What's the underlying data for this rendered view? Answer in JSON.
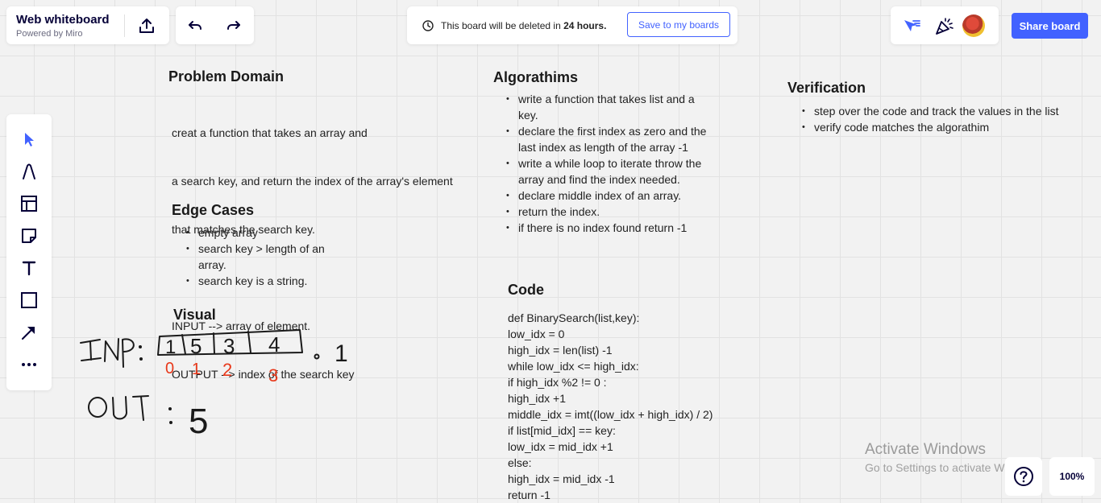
{
  "header": {
    "board_title": "Web whiteboard",
    "powered_by": "Powered by Miro",
    "notice_prefix": "This board will be deleted in ",
    "notice_hours": "24 hours.",
    "save_label": "Save to my boards",
    "share_label": "Share board"
  },
  "toolbar": {
    "tools": [
      "select-icon",
      "pen-icon",
      "frame-icon",
      "sticky-note-icon",
      "text-icon",
      "shape-icon",
      "connector-arrow-icon",
      "more-icon"
    ]
  },
  "problem": {
    "title": "Problem Domain",
    "lines": [
      "creat a function that takes an array and",
      "a search key, and return the index of the array's element",
      "that matches the search key.",
      "",
      "INPUT --> array of element.",
      "OUTPUT --> index of the search key"
    ]
  },
  "edge": {
    "title": "Edge Cases",
    "items": [
      "empty array",
      "search key > length of an array.",
      "search key is a string."
    ]
  },
  "visual": {
    "title": "Visual",
    "inp_label": "INP:",
    "array_values": [
      "1",
      "5",
      "3",
      "4"
    ],
    "index_values": [
      "0",
      "1",
      "2",
      "3"
    ],
    "key_value": "1",
    "out_label": "OUT",
    "out_value": "5"
  },
  "algorithms": {
    "title": "Algorathims",
    "items": [
      "write a function that takes list and a key.",
      "declare the first index as zero and the last index as length of the array -1",
      "write a while loop to iterate throw the array and find the index needed.",
      "declare middle index of an array.",
      "return the index.",
      "if there is no index found return -1"
    ]
  },
  "code": {
    "title": "Code",
    "lines": [
      "def BinarySearch(list,key):",
      "low_idx = 0",
      "high_idx = len(list) -1",
      "while low_idx <= high_idx:",
      "if high_idx %2 != 0 :",
      "high_idx +1",
      "middle_idx = imt((low_idx + high_idx) / 2)",
      "if list[mid_idx] == key:",
      "low_idx = mid_idx +1",
      "else:",
      "high_idx = mid_idx -1",
      "return -1"
    ]
  },
  "verification": {
    "title": "Verification",
    "items": [
      "step over the code and track the values in the list",
      "verify code matches the algorathim"
    ]
  },
  "watermark": {
    "title": "Activate Windows",
    "subtitle": "Go to Settings to activate Windows."
  },
  "zoom": {
    "level": "100%"
  },
  "colors": {
    "accent": "#4262ff",
    "ink": "#1a1a1a",
    "red_ink": "#e8381a"
  }
}
